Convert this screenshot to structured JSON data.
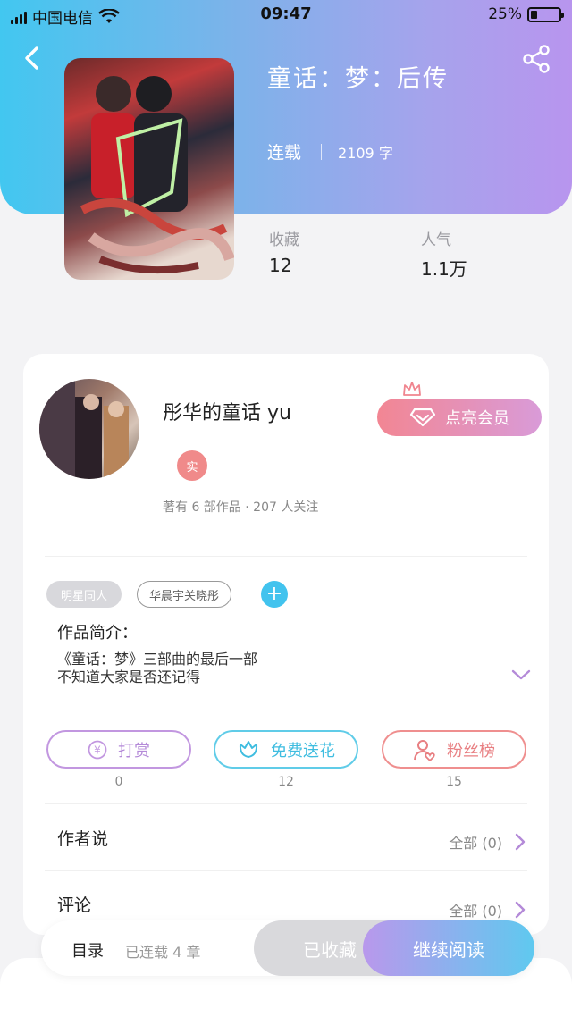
{
  "status_bar": {
    "carrier": "中国电信",
    "time": "09:47",
    "battery": "25%"
  },
  "book": {
    "title": "童话：梦：后传",
    "status": "连载",
    "word_count": "2109 字",
    "favorites_label": "收藏",
    "favorites_value": "12",
    "popularity_label": "人气",
    "popularity_value": "1.1万"
  },
  "author": {
    "name": "彤华的童话 yu",
    "verified_badge": "实",
    "stats": "著有 6 部作品 · 207 人关注",
    "vip_button": "点亮会员"
  },
  "tags": [
    "明星同人",
    "华晨宇关晓彤"
  ],
  "intro": {
    "heading": "作品简介：",
    "line1": "《童话：梦》三部曲的最后一部",
    "line2": "不知道大家是否还记得"
  },
  "actions": [
    {
      "label": "打赏",
      "count": "0"
    },
    {
      "label": "免费送花",
      "count": "12"
    },
    {
      "label": "粉丝榜",
      "count": "15"
    }
  ],
  "sections": {
    "author_says": {
      "title": "作者说",
      "link": "全部 (0)"
    },
    "comments": {
      "title": "评论",
      "link": "全部 (0)"
    }
  },
  "bottom_bar": {
    "toc": "目录",
    "chapters": "已连载 4 章",
    "saved_button": "已收藏",
    "read_button": "继续阅读"
  },
  "colors": {
    "accent_blue": "#42c7f0",
    "accent_purple": "#b895ee",
    "pink": "#f28693"
  },
  "icons": [
    "back-icon",
    "share-icon",
    "crown-icon",
    "diamond-icon",
    "yen-icon",
    "flower-icon",
    "fans-icon",
    "chevron-right-icon",
    "chevron-down-icon",
    "plus-icon"
  ]
}
